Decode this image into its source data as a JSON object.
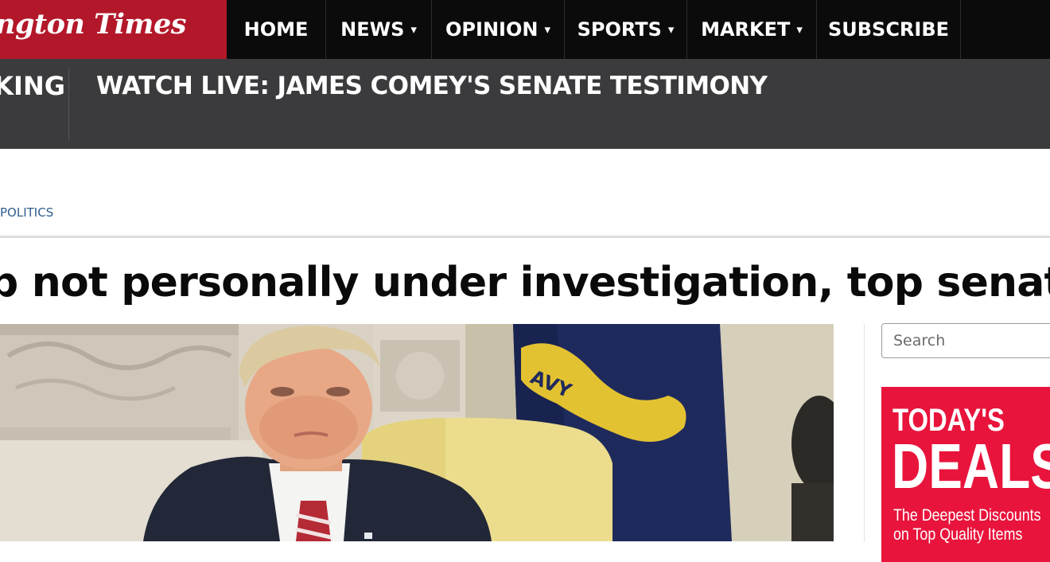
{
  "header": {
    "logo_text": "ngton Times",
    "nav": [
      {
        "label": "HOME",
        "has_dropdown": false
      },
      {
        "label": "NEWS",
        "has_dropdown": true
      },
      {
        "label": "OPINION",
        "has_dropdown": true
      },
      {
        "label": "SPORTS",
        "has_dropdown": true
      },
      {
        "label": "MARKET",
        "has_dropdown": true
      },
      {
        "label": "SUBSCRIBE",
        "has_dropdown": false
      }
    ],
    "dropdown_caret": "▾"
  },
  "breaking": {
    "label": "BREAKING",
    "headline": "WATCH LIVE: JAMES COMEY'S SENATE TESTIMONY"
  },
  "article": {
    "section": "POLITICS",
    "title": "p not personally under investigation, top senators"
  },
  "sidebar": {
    "search_placeholder": "Search",
    "ad": {
      "line1": "TODAY'S",
      "line2": "DEALS",
      "line3": "The Deepest Discounts",
      "line4": "on Top Quality Items"
    }
  },
  "colors": {
    "brand_red": "#b3182a",
    "nav_bg": "#0b0b0b",
    "breaking_bg": "#3b3b3d",
    "section_link": "#2e5d8e",
    "ad_red": "#e8143c"
  }
}
